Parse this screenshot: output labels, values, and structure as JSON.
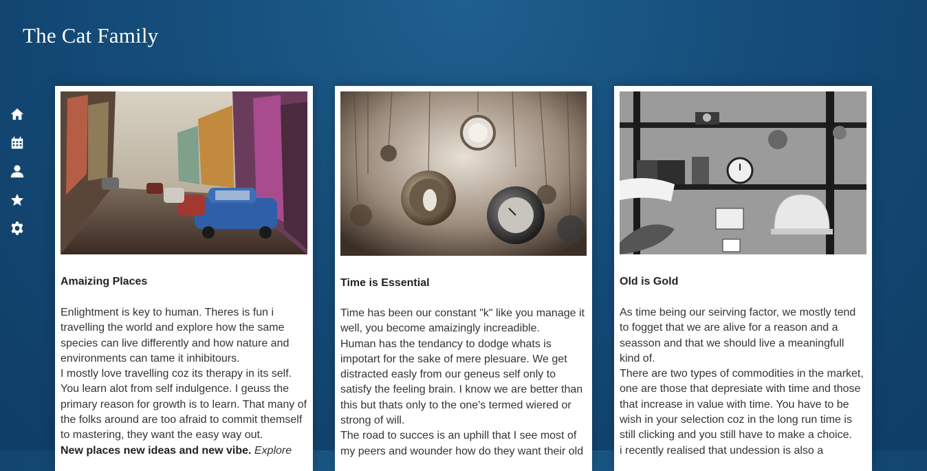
{
  "site": {
    "title": "The Cat Family"
  },
  "sidebar": {
    "items": [
      {
        "icon": "home-icon"
      },
      {
        "icon": "calendar-icon"
      },
      {
        "icon": "user-icon"
      },
      {
        "icon": "star-icon"
      },
      {
        "icon": "gear-icon"
      }
    ]
  },
  "cards": [
    {
      "title": "Amaizing Places",
      "paragraphs": [
        "Enlightment is key to human. Theres is fun i travelling the world and explore how the same species can live differently and how nature and environments can tame it inhibitours.",
        "I mostly love travelling coz its therapy in its self. You learn alot from self indulgence. I geuss the primary reason for growth is to learn. That many of the folks around are too afraid to commit themself to mastering, they want the easy way out."
      ],
      "bold_line": "New places new ideas and new vibe.",
      "italic_tail": "Explore"
    },
    {
      "title": "Time is Essential",
      "paragraphs": [
        "Time has been our constant \"k\" like you manage it well, you become amaizingly increadible.",
        "Human has the tendancy to dodge whats is impotart for the sake of mere plesuare. We get distracted easly from our geneus self only to satisfy the feeling brain. I know we are better than this but thats only to the one's termed wiered or strong of will.",
        "The road to succes is an uphill that I see most of my peers and wounder how do they want their old"
      ]
    },
    {
      "title": "Old is Gold",
      "paragraphs": [
        "As time being our seirving factor, we mostly tend to fogget that we are alive for a reason and a seasson and that we should live a meaningfull kind of.",
        "There are two types of commodities in the market, one are those that depresiate with time and those that increase in value with time. You have to be wish in your selection coz in the long run time is still clicking and you still have to make a choice.",
        "i recently realised that undession is also a"
      ]
    }
  ]
}
